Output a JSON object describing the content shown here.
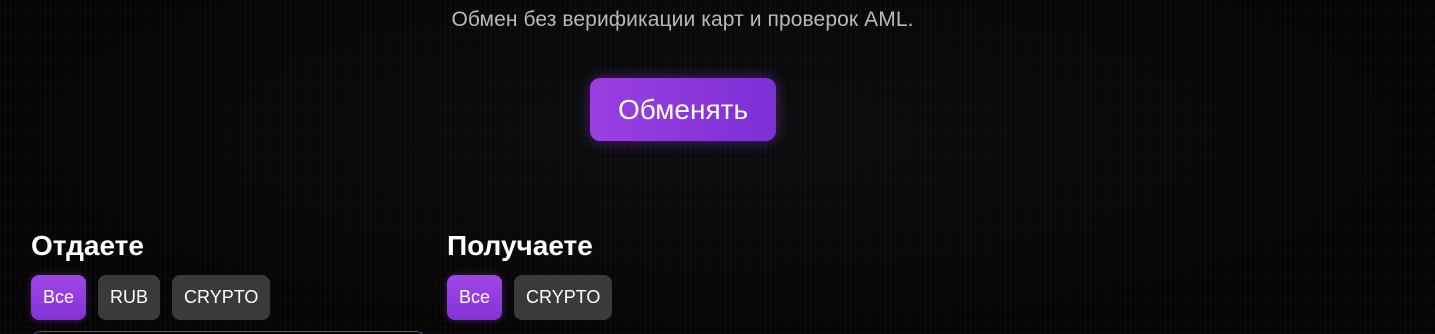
{
  "hero": {
    "subtitle": "Обмен без верификации карт и проверок AML.",
    "cta_label": "Обменять"
  },
  "give": {
    "title": "Отдаете",
    "filters": [
      {
        "label": "Все",
        "active": true
      },
      {
        "label": "RUB",
        "active": false
      },
      {
        "label": "CRYPTO",
        "active": false
      }
    ]
  },
  "get": {
    "title": "Получаете",
    "filters": [
      {
        "label": "Все",
        "active": true
      },
      {
        "label": "CRYPTO",
        "active": false
      }
    ]
  },
  "colors": {
    "background": "#050505",
    "accent": "#8b3adb",
    "chip_inactive": "#3a3a3c",
    "subtitle": "#b9b9bd"
  }
}
